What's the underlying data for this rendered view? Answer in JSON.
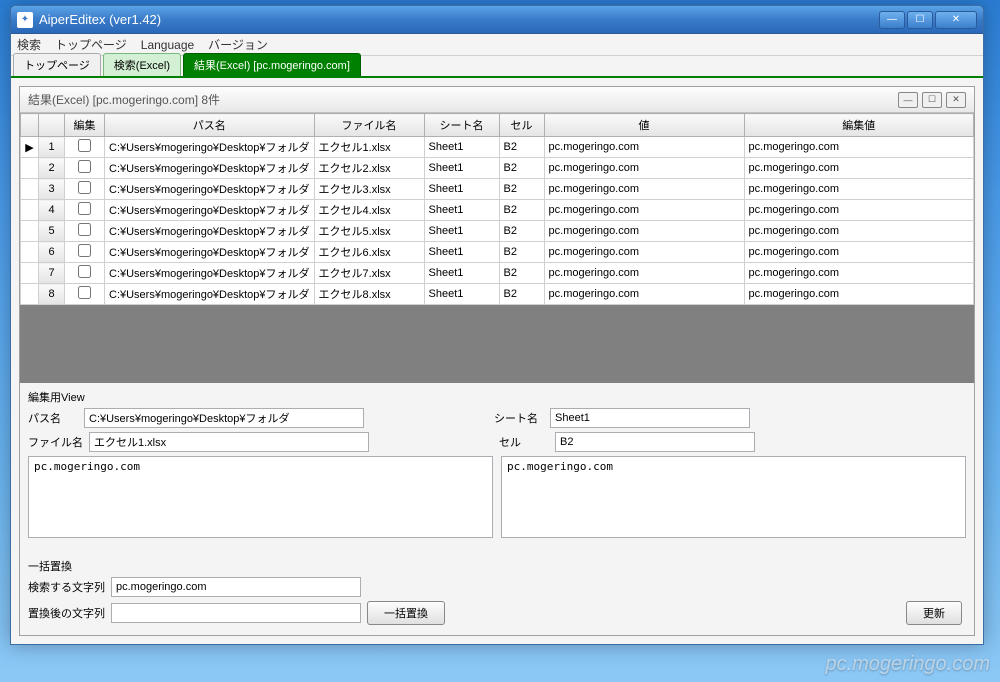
{
  "window": {
    "title": "AiperEditex (ver1.42)"
  },
  "menu": {
    "search": "検索",
    "toppage": "トップページ",
    "language": "Language",
    "version": "バージョン"
  },
  "tabs": {
    "toppage": "トップページ",
    "search_excel": "検索(Excel)",
    "result_excel": "結果(Excel) [pc.mogeringo.com]"
  },
  "panel": {
    "title": "結果(Excel) [pc.mogeringo.com]  8件"
  },
  "grid": {
    "headers": {
      "edit": "編集",
      "path": "パス名",
      "filename": "ファイル名",
      "sheet": "シート名",
      "cell": "セル",
      "value": "値",
      "editvalue": "編集値"
    },
    "rows": [
      {
        "n": "1",
        "path": "C:¥Users¥mogeringo¥Desktop¥フォルダ",
        "file": "エクセル1.xlsx",
        "sheet": "Sheet1",
        "cell": "B2",
        "value": "pc.mogeringo.com",
        "editvalue": "pc.mogeringo.com",
        "arrow": "▶"
      },
      {
        "n": "2",
        "path": "C:¥Users¥mogeringo¥Desktop¥フォルダ",
        "file": "エクセル2.xlsx",
        "sheet": "Sheet1",
        "cell": "B2",
        "value": "pc.mogeringo.com",
        "editvalue": "pc.mogeringo.com",
        "arrow": ""
      },
      {
        "n": "3",
        "path": "C:¥Users¥mogeringo¥Desktop¥フォルダ",
        "file": "エクセル3.xlsx",
        "sheet": "Sheet1",
        "cell": "B2",
        "value": "pc.mogeringo.com",
        "editvalue": "pc.mogeringo.com",
        "arrow": ""
      },
      {
        "n": "4",
        "path": "C:¥Users¥mogeringo¥Desktop¥フォルダ",
        "file": "エクセル4.xlsx",
        "sheet": "Sheet1",
        "cell": "B2",
        "value": "pc.mogeringo.com",
        "editvalue": "pc.mogeringo.com",
        "arrow": ""
      },
      {
        "n": "5",
        "path": "C:¥Users¥mogeringo¥Desktop¥フォルダ",
        "file": "エクセル5.xlsx",
        "sheet": "Sheet1",
        "cell": "B2",
        "value": "pc.mogeringo.com",
        "editvalue": "pc.mogeringo.com",
        "arrow": ""
      },
      {
        "n": "6",
        "path": "C:¥Users¥mogeringo¥Desktop¥フォルダ",
        "file": "エクセル6.xlsx",
        "sheet": "Sheet1",
        "cell": "B2",
        "value": "pc.mogeringo.com",
        "editvalue": "pc.mogeringo.com",
        "arrow": ""
      },
      {
        "n": "7",
        "path": "C:¥Users¥mogeringo¥Desktop¥フォルダ",
        "file": "エクセル7.xlsx",
        "sheet": "Sheet1",
        "cell": "B2",
        "value": "pc.mogeringo.com",
        "editvalue": "pc.mogeringo.com",
        "arrow": ""
      },
      {
        "n": "8",
        "path": "C:¥Users¥mogeringo¥Desktop¥フォルダ",
        "file": "エクセル8.xlsx",
        "sheet": "Sheet1",
        "cell": "B2",
        "value": "pc.mogeringo.com",
        "editvalue": "pc.mogeringo.com",
        "arrow": ""
      }
    ]
  },
  "editor": {
    "title": "編集用View",
    "path_label": "パス名",
    "path_value": "C:¥Users¥mogeringo¥Desktop¥フォルダ",
    "file_label": "ファイル名",
    "file_value": "エクセル1.xlsx",
    "sheet_label": "シート名",
    "sheet_value": "Sheet1",
    "cell_label": "セル",
    "cell_value": "B2",
    "left_text": "pc.mogeringo.com",
    "right_text": "pc.mogeringo.com"
  },
  "replace": {
    "title": "一括置換",
    "search_label": "検索する文字列",
    "search_value": "pc.mogeringo.com",
    "after_label": "置換後の文字列",
    "after_value": "",
    "button": "一括置換",
    "update": "更新"
  },
  "watermark": "pc.mogeringo.com"
}
